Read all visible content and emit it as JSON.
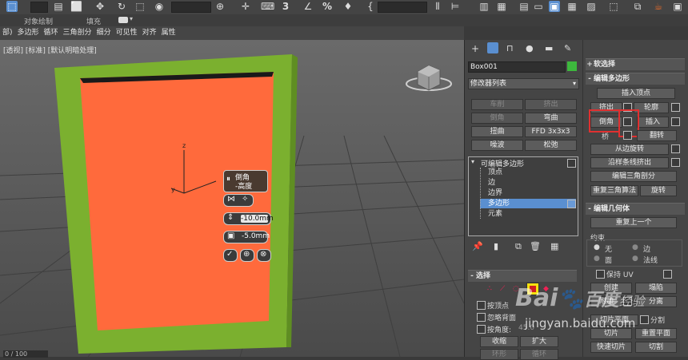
{
  "ribbon": {
    "labels": [
      "对象绘制",
      "填充"
    ],
    "tabs": [
      "部)",
      "多边形",
      "循环",
      "三角剖分",
      "细分",
      "可见性",
      "对齐",
      "属性"
    ]
  },
  "viewport": {
    "label": "[+] [透视] [标准] [默认明暗处理]",
    "label_display": "[透视] [标准] [默认明暗处理]",
    "axis_z": "z",
    "axis_y": "y",
    "colors": {
      "frame": "#7bb02f",
      "face": "#ff6a3c",
      "background": "#5a5a5a"
    }
  },
  "caddy": {
    "title": "倒角",
    "subtitle": "-高度",
    "height_value": "-10.0mm",
    "outline_value": "-5.0mm"
  },
  "status": {
    "frame_counter": "0 / 100"
  },
  "command_panel": {
    "object_name": "Box001",
    "object_color": "#3db83d",
    "modifier_list_label": "修改器列表",
    "modifier_buttons": [
      [
        "车削",
        "挤出"
      ],
      [
        "倒角",
        "弯曲"
      ],
      [
        "扭曲",
        "FFD 3x3x3"
      ],
      [
        "噪波",
        "松弛"
      ]
    ],
    "stack": {
      "root": "可编辑多边形",
      "items": [
        "顶点",
        "边",
        "边界",
        "多边形",
        "元素"
      ],
      "selected": "多边形"
    },
    "selection": {
      "title": "选择",
      "checkboxes": [
        "按顶点",
        "忽略背面",
        "按角度:"
      ],
      "angle_value": "45.0",
      "buttons": [
        "收缩",
        "扩大"
      ],
      "bottom_buttons": [
        "环形",
        "循环"
      ]
    }
  },
  "right_panel": {
    "soft_selection": "软选择",
    "edit_polygons": {
      "title": "编辑多边形",
      "insert_vertex": "插入顶点",
      "extrude": "挤出",
      "outline": "轮廓",
      "bevel": "倒角",
      "inset": "插入",
      "bridge": "桥",
      "flip": "翻转",
      "hinge_from_edge": "从边旋转",
      "extrude_along_spline": "沿样条线挤出",
      "edit_triangulation": "编辑三角剖分",
      "retriangulate": "重复三角算法",
      "turn": "旋转"
    },
    "edit_geometry": {
      "title": "编辑几何体",
      "repeat_last": "重复上一个",
      "constraints": "约束",
      "radio_none": "无",
      "radio_edge": "边",
      "radio_face": "面",
      "radio_normal": "法线",
      "preserve_uv": "保持 UV",
      "create": "创建",
      "collapse": "塌陷",
      "attach": "附加",
      "detach": "分离",
      "slice_plane": "切片平面",
      "split": "分割",
      "slice": "切片",
      "reset_plane": "重置平面",
      "quickslice": "快速切片",
      "cut": "切割"
    }
  },
  "watermark": {
    "brand": "Bai",
    "brand2": "百度",
    "suffix": "经验",
    "url": "jingyan.baidu.com"
  }
}
